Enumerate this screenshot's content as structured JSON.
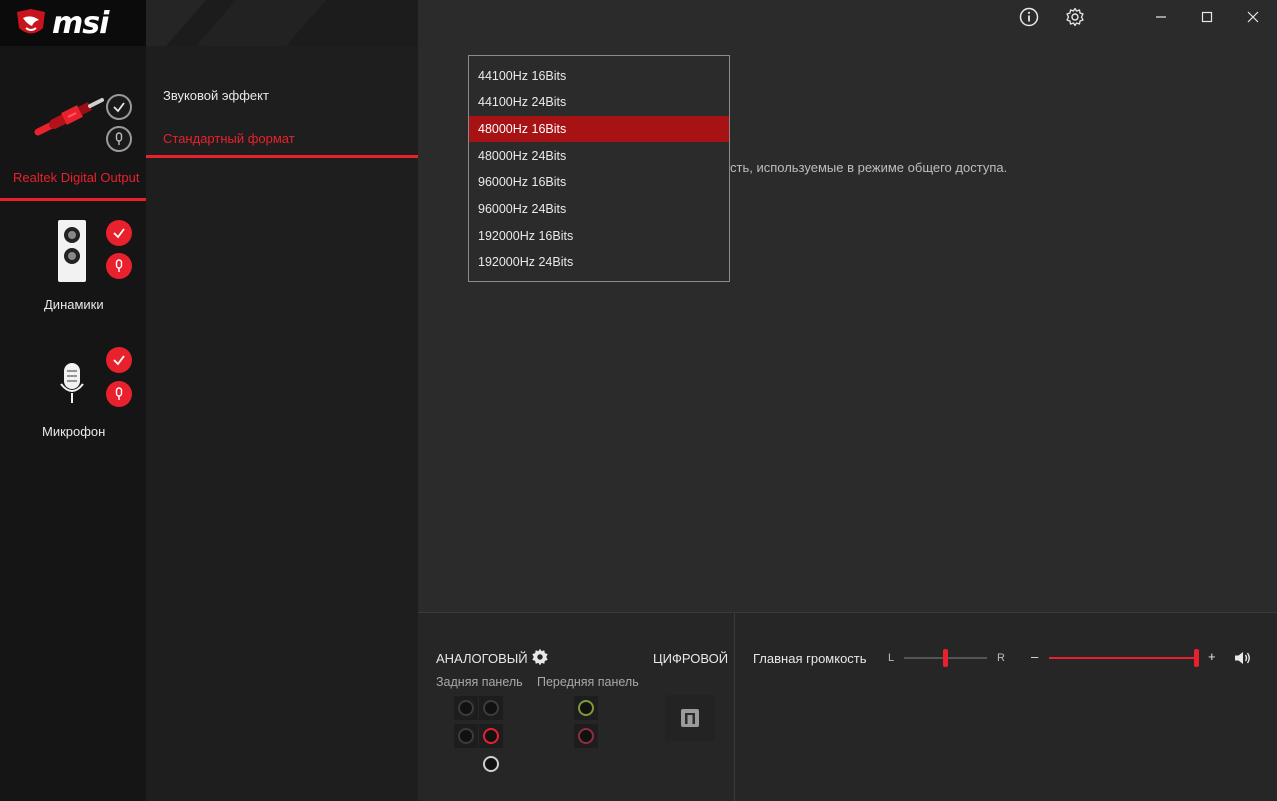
{
  "app": {
    "brand": "msi"
  },
  "titlebar": {
    "info_icon": "info-icon",
    "settings_icon": "gear-icon",
    "minimize_icon": "minimize-icon",
    "maximize_icon": "maximize-icon",
    "close_icon": "close-icon"
  },
  "devices": [
    {
      "label": "Realtek Digital Output",
      "active": true
    },
    {
      "label": "Динамики",
      "active": false
    },
    {
      "label": "Микрофон",
      "active": false
    }
  ],
  "menu": {
    "items": [
      {
        "label": "Звуковой эффект",
        "active": false
      },
      {
        "label": "Стандартный формат",
        "active": true
      }
    ]
  },
  "content": {
    "description": "сть, используемые в режиме общего доступа."
  },
  "format_dropdown": {
    "options": [
      "44100Hz 16Bits",
      "44100Hz 24Bits",
      "48000Hz 16Bits",
      "48000Hz 24Bits",
      "96000Hz 16Bits",
      "96000Hz 24Bits",
      "192000Hz 16Bits",
      "192000Hz 24Bits"
    ],
    "selected": "48000Hz 16Bits"
  },
  "connectors": {
    "analog_label": "АНАЛОГОВЫЙ",
    "digital_label": "ЦИФРОВОЙ",
    "rear_panel_label": "Задняя панель",
    "front_panel_label": "Передняя панель"
  },
  "volume": {
    "label": "Главная громкость",
    "balance_left": "L",
    "balance_right": "R",
    "minus": "–",
    "plus": "+",
    "level": 1.0,
    "balance": 0.5
  },
  "colors": {
    "accent": "#e8212d",
    "selected_bg": "#a71214",
    "jack_green": "#7d9a3a",
    "jack_pink": "#8a3040"
  }
}
